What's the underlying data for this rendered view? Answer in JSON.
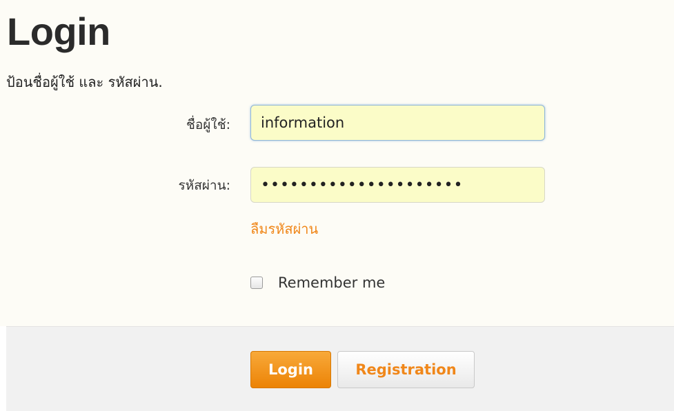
{
  "page": {
    "title": "Login",
    "subtitle": "ป้อนชื่อผู้ใช้ และ รหัสผ่าน."
  },
  "form": {
    "username_label": "ชื่อผู้ใช้:",
    "username_value": "information",
    "password_label": "รหัสผ่าน:",
    "password_value": "•••••••••••••••••••••",
    "forgot_password_link": "ลืมรหัสผ่าน",
    "remember_label": "Remember me",
    "remember_checked": false
  },
  "actions": {
    "login_label": "Login",
    "registration_label": "Registration"
  },
  "colors": {
    "accent": "#f0871a",
    "input_background": "#fbfcc8",
    "footer_background": "#f1f1f1"
  }
}
